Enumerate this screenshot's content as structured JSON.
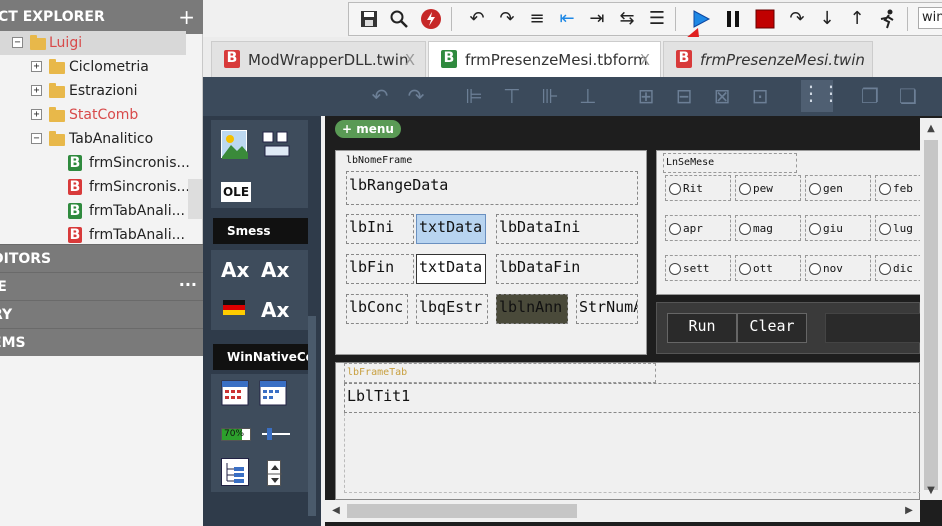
{
  "explorer": {
    "title": "CT EXPLORER",
    "tree": [
      {
        "label": "Luigi",
        "type": "folder",
        "color": "#d84a4a",
        "expand": "-"
      },
      {
        "label": "Ciclometria",
        "type": "folder",
        "color": "#222",
        "expand": "+"
      },
      {
        "label": "Estrazioni",
        "type": "folder",
        "color": "#222",
        "expand": "+"
      },
      {
        "label": "StatComb",
        "type": "folder",
        "color": "#d84a4a",
        "expand": "+"
      },
      {
        "label": "TabAnalitico",
        "type": "folder",
        "color": "#222",
        "expand": "-"
      },
      {
        "label": "frmSincronis...",
        "type": "form",
        "icon": "green"
      },
      {
        "label": "frmSincronis...",
        "type": "form",
        "icon": "red"
      },
      {
        "label": "frmTabAnali...",
        "type": "form",
        "icon": "green"
      },
      {
        "label": "frmTabAnali...",
        "type": "form",
        "icon": "red"
      }
    ],
    "sections": [
      "DITORS",
      "IE",
      "RY",
      "EMS"
    ],
    "more": "···"
  },
  "toolbar": {
    "input_value": "win"
  },
  "tabs": [
    {
      "label": "ModWrapperDLL.twin",
      "active": false,
      "italic": false
    },
    {
      "label": "frmPresenzeMesi.tbform",
      "active": true,
      "italic": false
    },
    {
      "label": "frmPresenzeMesi.twin",
      "active": false,
      "italic": true
    }
  ],
  "palette": {
    "ole_label": "OLE",
    "smess_label": "Smess",
    "ax_labels": [
      "Ax",
      "Ax",
      "Ax"
    ],
    "winnative_label": "WinNativeCon",
    "progress_text": "70%"
  },
  "designer": {
    "menu_label": "+ menu",
    "left_frame": {
      "caption": "lbNomeFrame",
      "range": "lbRangeData",
      "row1": [
        "lbIni",
        "txtData",
        "lbDataIni"
      ],
      "row2": [
        "lbFin",
        "txtData",
        "lbDataFin"
      ],
      "row3": [
        "lbConc",
        "lbqEstr",
        "lblnAnn",
        "StrNumA"
      ]
    },
    "month_frame": {
      "caption": "LnSeMese",
      "months": [
        "Rit",
        "pew",
        "gen",
        "feb",
        "apr",
        "mag",
        "giu",
        "lug",
        "sett",
        "ott",
        "nov",
        "dic"
      ]
    },
    "buttons": [
      "Run",
      "Clear"
    ],
    "tab_frame": {
      "caption": "lbFrameTab",
      "title": "LblTit1"
    }
  },
  "colors": {
    "run_icon": "#1e88e5",
    "stop_icon": "#c00000",
    "arrow": "#e02020"
  }
}
